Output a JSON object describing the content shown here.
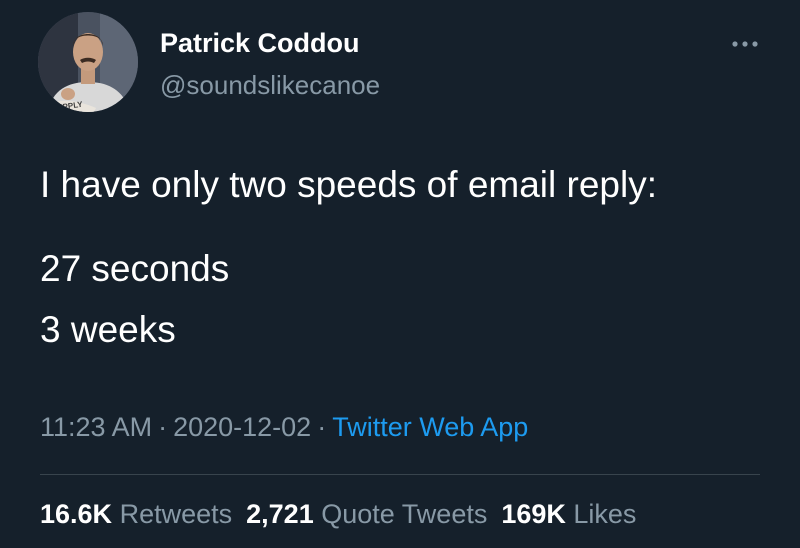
{
  "author": {
    "name": "Patrick Coddou",
    "handle": "@soundslikecanoe",
    "avatar_text": "SUPPLY"
  },
  "tweet": {
    "lines": [
      "I have only two speeds of email reply:",
      "27 seconds",
      "3 weeks"
    ]
  },
  "meta": {
    "time": "11:23 AM",
    "separator": "·",
    "date": "2020-12-02",
    "source": "Twitter Web App"
  },
  "stats": {
    "retweets_count": "16.6K",
    "retweets_label": "Retweets",
    "quotes_count": "2,721",
    "quotes_label": "Quote Tweets",
    "likes_count": "169K",
    "likes_label": "Likes"
  },
  "icons": {
    "more": "more-horizontal-icon"
  },
  "colors": {
    "background": "#15202b",
    "primary_text": "#ffffff",
    "secondary_text": "#8899a6",
    "link": "#1d9bf0",
    "divider": "#38444d"
  }
}
